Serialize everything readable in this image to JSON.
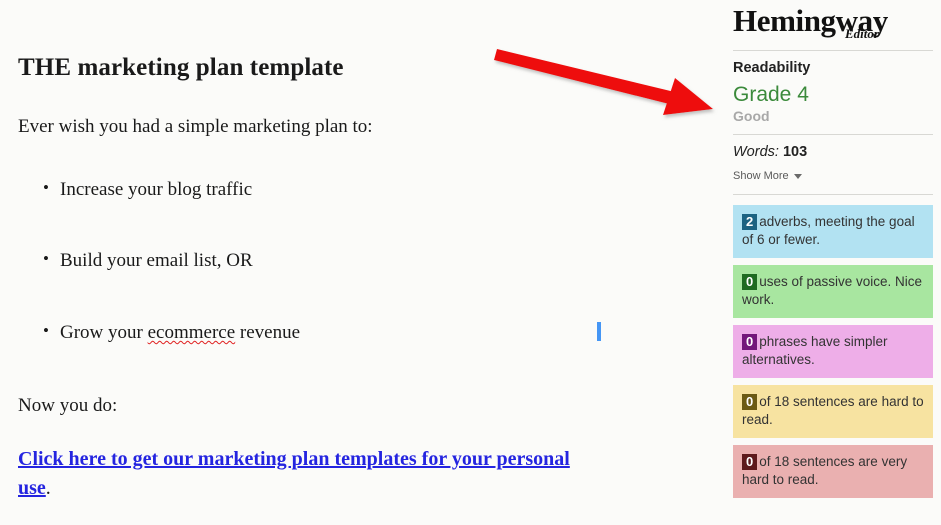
{
  "app": {
    "logo_main": "Hemingway",
    "logo_sub": "Editor"
  },
  "document": {
    "title": "THE marketing plan template",
    "intro": "Ever wish you had a simple marketing plan to:",
    "bullets": [
      {
        "text": "Increase your blog traffic"
      },
      {
        "text": "Build your email list, OR"
      },
      {
        "prefix": "Grow your ",
        "misspelled": "ecommerce",
        "suffix": " revenue"
      }
    ],
    "closing": "Now you do:",
    "link_text": "Click here to get our marketing plan templates for your personal use",
    "link_trailing": "."
  },
  "sidebar": {
    "readability": {
      "label": "Readability",
      "grade": "Grade 4",
      "quality": "Good",
      "grade_color": "#3b8a3b"
    },
    "stats": {
      "words_label": "Words:",
      "words_value": "103",
      "show_more": "Show More"
    },
    "hints": [
      {
        "key": "adverbs",
        "count": "2",
        "text": "adverbs, meeting the goal of 6 or fewer.",
        "bg": "#b2e2f2",
        "badge": "#1d6382"
      },
      {
        "key": "passive",
        "count": "0",
        "text": "uses of passive voice. Nice work.",
        "bg": "#a8e6a0",
        "badge": "#1e6b21"
      },
      {
        "key": "simpler",
        "count": "0",
        "text": "phrases have simpler alternatives.",
        "bg": "#eeaee8",
        "badge": "#73177a"
      },
      {
        "key": "hard",
        "count": "0",
        "text": "of 18 sentences are hard to read.",
        "bg": "#f7e3a1",
        "badge": "#6b5a14"
      },
      {
        "key": "veryhard",
        "count": "0",
        "text": "of 18 sentences are very hard to read.",
        "bg": "#eab0b0",
        "badge": "#5e1a1c"
      }
    ]
  },
  "annotation": {
    "arrow_color": "#ee1111"
  }
}
